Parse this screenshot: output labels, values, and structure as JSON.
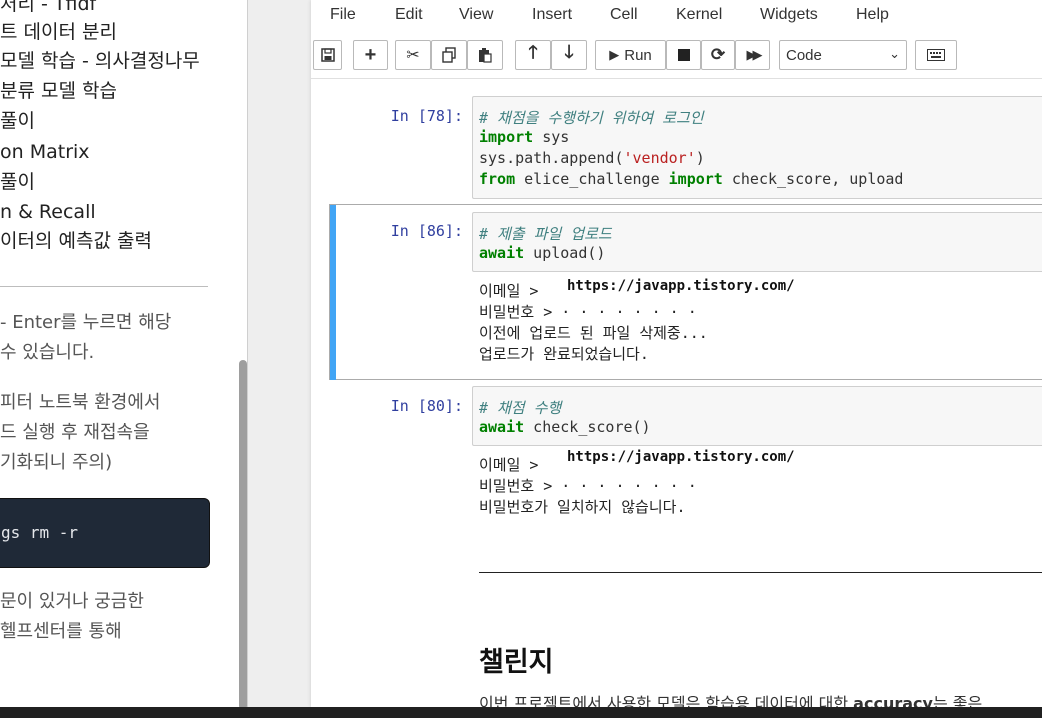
{
  "sidebar": {
    "toc": [
      "처리 - Tfidf",
      "트 데이터 분리",
      "모델 학습 - 의사결정나무",
      "분류 모델 학습",
      "풀이",
      "on Matrix",
      "풀이",
      "n & Recall",
      "이터의 예측값 출력"
    ],
    "paragraph1": [
      "- Enter를 누르면 해당",
      "수 있습니다."
    ],
    "paragraph2": [
      "피터 노트북 환경에서",
      "드 실행 후 재접속을",
      "기화되니 주의)"
    ],
    "code": "gs rm -r",
    "paragraph3": [
      "문이 있거나 궁금한",
      " 헬프센터를 통해"
    ]
  },
  "menu": [
    "File",
    "Edit",
    "View",
    "Insert",
    "Cell",
    "Kernel",
    "Widgets",
    "Help"
  ],
  "toolbar": {
    "save_icon": "save-icon",
    "add_icon": "plus-icon",
    "cut_icon": "scissors-icon",
    "copy_icon": "copy-icon",
    "paste_icon": "paste-icon",
    "up_icon": "arrow-up-icon",
    "down_icon": "arrow-down-icon",
    "run_label": "Run",
    "cell_type": "Code",
    "keyboard_icon": "keyboard-icon"
  },
  "cells": [
    {
      "prompt": "In [78]:",
      "lines": [
        [
          {
            "t": "# 채점을 수행하기 위하여 로그인",
            "c": "cm"
          }
        ],
        [
          {
            "t": "import",
            "c": "kw"
          },
          {
            "t": " sys",
            "c": ""
          }
        ],
        [
          {
            "t": "sys.path.append(",
            "c": ""
          },
          {
            "t": "'vendor'",
            "c": "str"
          },
          {
            "t": ")",
            "c": ""
          }
        ],
        [
          {
            "t": "from",
            "c": "kw"
          },
          {
            "t": " elice_challenge ",
            "c": ""
          },
          {
            "t": "import",
            "c": "kw"
          },
          {
            "t": " check_score, upload",
            "c": ""
          }
        ]
      ]
    },
    {
      "prompt": "In [86]:",
      "lines": [
        [
          {
            "t": "# 제출 파일 업로드",
            "c": "cm"
          }
        ],
        [
          {
            "t": "await",
            "c": "kw"
          },
          {
            "t": " upload()",
            "c": ""
          }
        ]
      ],
      "output": [
        "이메일 >",
        "비밀번호 > · · · · · · · ·",
        "이전에 업로드 된 파일 삭제중...",
        "업로드가 완료되었습니다."
      ]
    },
    {
      "prompt": "In [80]:",
      "lines": [
        [
          {
            "t": "# 채점 수행",
            "c": "cm"
          }
        ],
        [
          {
            "t": "await",
            "c": "kw"
          },
          {
            "t": " check_score()",
            "c": ""
          }
        ]
      ],
      "output": [
        "이메일 >",
        "비밀번호 > · · · · · · · ·",
        "비밀번호가 일치하지 않습니다."
      ]
    }
  ],
  "watermark": "https://javapp.tistory.com/",
  "markdown": {
    "heading": "챌린지",
    "text_before": "이번 프로젝트에서 사용한 모델은 학습용 데이터에 대한 ",
    "text_bold": "accuracy",
    "text_after": "는 좋은"
  }
}
